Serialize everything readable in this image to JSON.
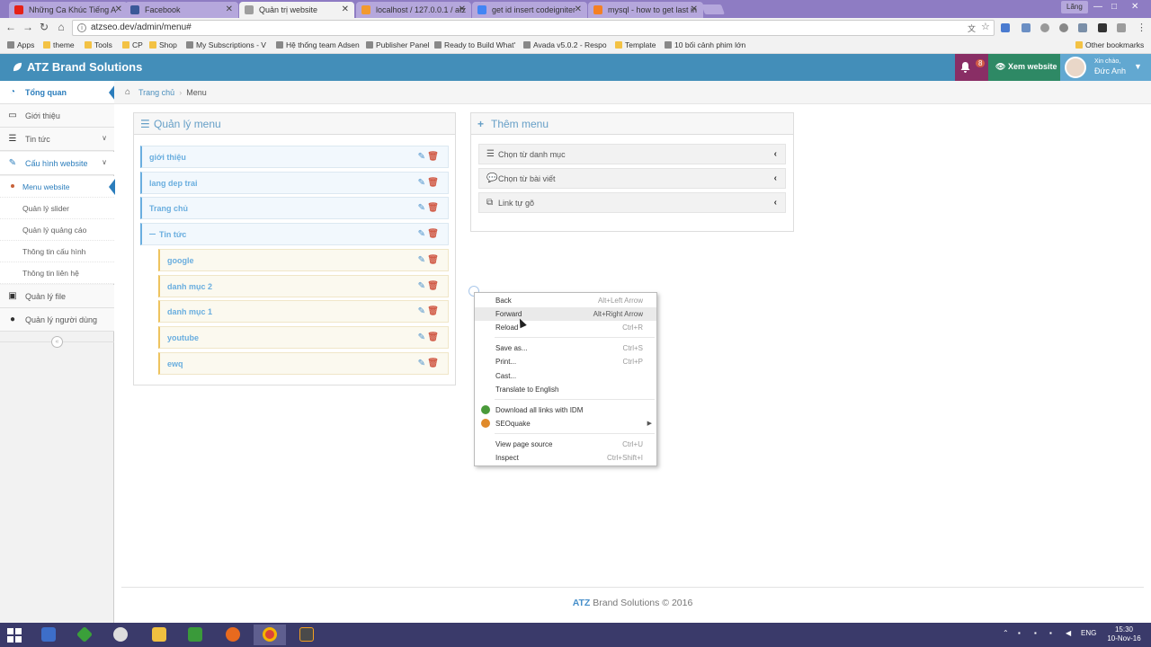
{
  "browser": {
    "tabs": [
      {
        "label": "Những Ca Khúc Tiếng A",
        "favcolor": "#e62117",
        "active": false
      },
      {
        "label": "Facebook",
        "favcolor": "#3b5998",
        "active": false
      },
      {
        "label": "Quản trị website",
        "favcolor": "#9e9e9e",
        "active": true
      },
      {
        "label": "localhost / 127.0.0.1 / atz",
        "favcolor": "#f29a2e",
        "active": false
      },
      {
        "label": "get id insert codeigniter",
        "favcolor": "#4285f4",
        "active": false
      },
      {
        "label": "mysql - how to get last in",
        "favcolor": "#f48024",
        "active": false
      }
    ],
    "profile": "Lãng",
    "url": "atzseo.dev/admin/menu#",
    "bookmarks": [
      "Apps",
      "theme",
      "Tools",
      "CP",
      "Shop",
      "My Subscriptions - V",
      "Hệ thống team Adsen",
      "Publisher Panel",
      "Ready to Build What'",
      "Avada v5.0.2 - Respo",
      "Template",
      "10 bối cảnh phim lớn"
    ],
    "other_bookmarks": "Other bookmarks"
  },
  "header": {
    "brand": "ATZ Brand Solutions",
    "notif_count": "8",
    "view_site": "Xem website",
    "greeting": "Xin chào,",
    "username": "Đức Anh"
  },
  "sidebar": {
    "items": [
      {
        "label": "Tổng quan",
        "icon": "dashboard-icon"
      },
      {
        "label": "Giới thiệu",
        "icon": "desktop-icon"
      },
      {
        "label": "Tin tức",
        "icon": "list-icon"
      },
      {
        "label": "Cấu hình website",
        "icon": "edit-icon"
      }
    ],
    "subitems": [
      "Menu website",
      "Quản lý slider",
      "Quản lý quảng cáo",
      "Thông tin cấu hình",
      "Thông tin liên hệ"
    ],
    "bottom_items": [
      {
        "label": "Quản lý file",
        "icon": "picture-icon"
      },
      {
        "label": "Quản lý người dùng",
        "icon": "user-icon"
      }
    ]
  },
  "breadcrumb": {
    "home": "Trang chủ",
    "current": "Menu"
  },
  "menu_panel": {
    "title": "Quản lý menu",
    "items": [
      {
        "label": "giới thiệu",
        "child": false
      },
      {
        "label": "lang dep trai",
        "child": false
      },
      {
        "label": "Trang chủ",
        "child": false
      },
      {
        "label": "Tin tức",
        "child": false,
        "parent": true
      },
      {
        "label": "google",
        "child": true
      },
      {
        "label": "danh mục 2",
        "child": true
      },
      {
        "label": "danh mục 1",
        "child": true
      },
      {
        "label": "youtube",
        "child": true
      },
      {
        "label": "ewq",
        "child": true
      }
    ]
  },
  "add_panel": {
    "title": "Thêm menu",
    "rows": [
      "Chọn từ danh mục",
      "Chọn từ bài viết",
      "Link tự gõ"
    ]
  },
  "context_menu": {
    "items": [
      {
        "label": "Back",
        "shortcut": "Alt+Left Arrow"
      },
      {
        "label": "Forward",
        "shortcut": "Alt+Right Arrow"
      },
      {
        "label": "Reload",
        "shortcut": "Ctrl+R"
      },
      {
        "label": "Save as...",
        "shortcut": "Ctrl+S"
      },
      {
        "label": "Print...",
        "shortcut": "Ctrl+P"
      },
      {
        "label": "Cast...",
        "shortcut": ""
      },
      {
        "label": "Translate to English",
        "shortcut": ""
      },
      {
        "label": "Download all links with IDM",
        "shortcut": ""
      },
      {
        "label": "SEOquake",
        "shortcut": ""
      },
      {
        "label": "View page source",
        "shortcut": "Ctrl+U"
      },
      {
        "label": "Inspect",
        "shortcut": "Ctrl+Shift+I"
      }
    ]
  },
  "footer": {
    "brand": "ATZ",
    "rest": " Brand Solutions © 2016"
  },
  "taskbar": {
    "lang": "ENG",
    "time": "15:30",
    "date": "10-Nov-16"
  }
}
